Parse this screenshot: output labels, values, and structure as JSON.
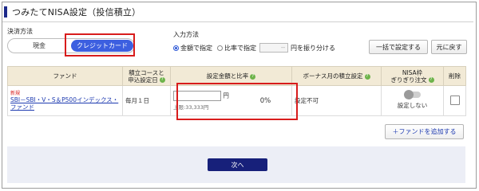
{
  "page": {
    "title": "つみたてNISA設定（投信積立）"
  },
  "payment": {
    "label": "決済方法",
    "options": [
      "現金",
      "クレジットカード"
    ],
    "selected": "クレジットカード"
  },
  "input_method": {
    "label": "入力方法",
    "option_amount": "金額で指定",
    "option_ratio": "比率で指定",
    "ratio_placeholder": "--",
    "ratio_suffix": "円を振り分ける",
    "selected": "金額で指定"
  },
  "buttons": {
    "bulk_set": "一括で設定する",
    "reset": "元に戻す",
    "add_fund": "＋ファンドを追加する",
    "next": "次へ"
  },
  "table": {
    "headers": {
      "fund": "ファンド",
      "course_line1": "積立コースと",
      "course_line2": "申込設定日",
      "amount_ratio": "設定金額と比率",
      "bonus": "ボーナス月の積立設定",
      "nisa_line1": "NISA枠",
      "nisa_line2": "ぎりぎり注文",
      "delete": "削除"
    },
    "rows": [
      {
        "new_badge": "新規",
        "fund_name": "SBI－SBI・V・S＆P500インデックス・ファンド",
        "course": "毎月１日",
        "amount_unit": "円",
        "amount_cap": "上限:33,333円",
        "ratio": "0%",
        "bonus": "設定不可",
        "nisa_status": "設定しない"
      }
    ]
  },
  "colors": {
    "accent_blue": "#3c5fe0",
    "navy": "#17207a",
    "highlight_red": "#d81c1c",
    "header_beige": "#f2ead6",
    "help_green": "#6db34a"
  }
}
